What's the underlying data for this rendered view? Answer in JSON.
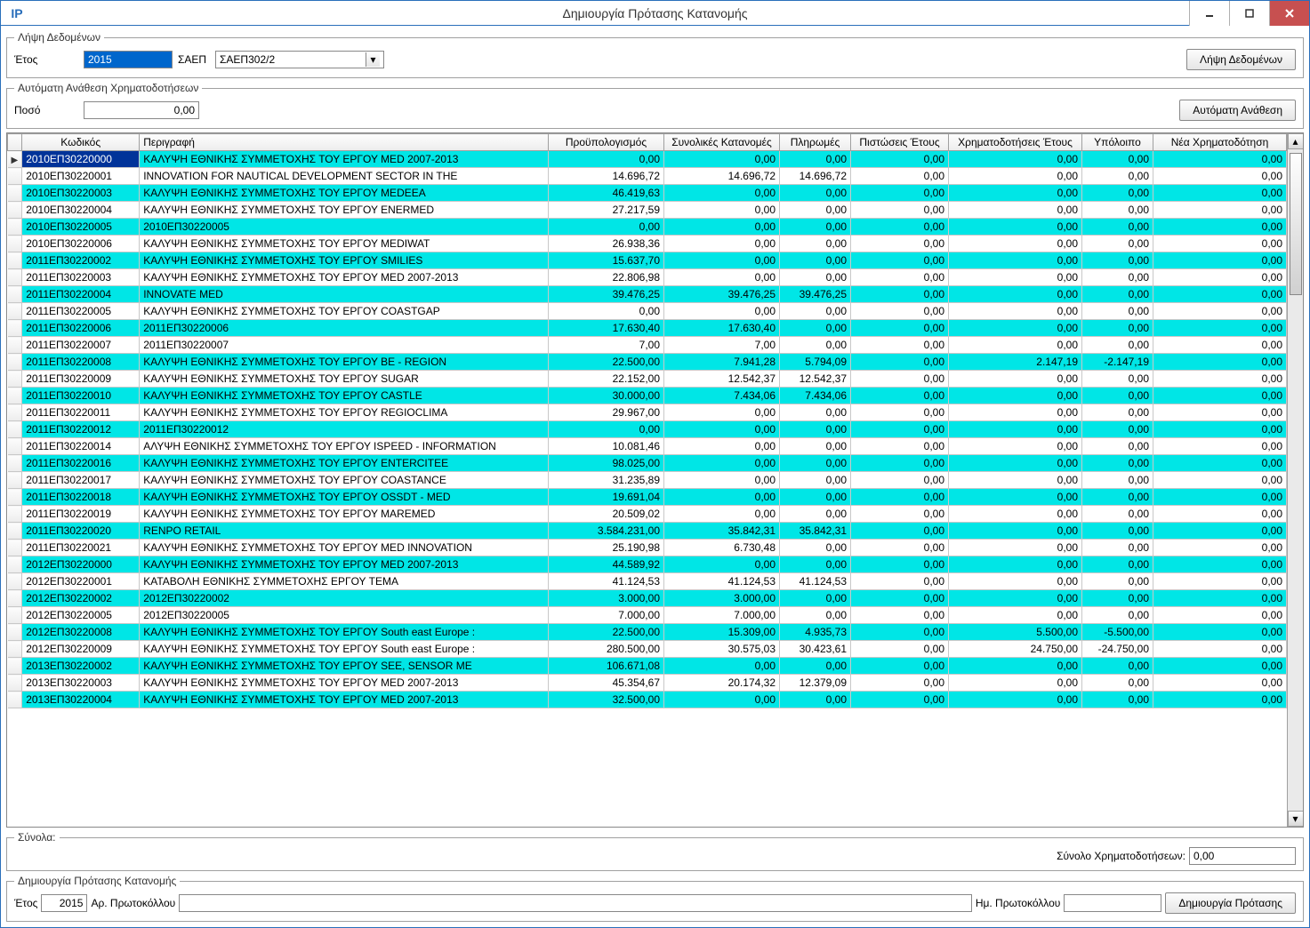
{
  "window": {
    "title": "Δημιουργία Πρότασης Κατανομής"
  },
  "section_fetch": {
    "legend": "Λήψη Δεδομένων",
    "year_label": "Έτος",
    "year_value": "2015",
    "saep_label": "ΣΑΕΠ",
    "saep_value": "ΣΑΕΠ302/2",
    "button": "Λήψη Δεδομένων"
  },
  "section_auto": {
    "legend": "Αυτόματη Ανάθεση Χρηματοδοτήσεων",
    "amount_label": "Ποσό",
    "amount_value": "0,00",
    "button": "Αυτόματη Ανάθεση"
  },
  "columns": {
    "code": "Κωδικός",
    "desc": "Περιγραφή",
    "budget": "Προϋπολογισμός",
    "total_alloc": "Συνολικές Κατανομές",
    "payments": "Πληρωμές",
    "year_credit": "Πιστώσεις Έτους",
    "year_fund": "Χρηματοδοτήσεις Έτους",
    "balance": "Υπόλοιπο",
    "new_fund": "Νέα Χρηματοδότηση"
  },
  "rows": [
    {
      "hi": true,
      "sel": true,
      "code": "2010ΕΠ30220000",
      "desc": "ΚΑΛΥΨΗ ΕΘΝΙΚΗΣ ΣΥΜΜΕΤΟΧΗΣ ΤΟΥ ΕΡΓΟΥ MED 2007-2013",
      "budget": "0,00",
      "alloc": "0,00",
      "pay": "0,00",
      "credit": "0,00",
      "fund": "0,00",
      "bal": "0,00",
      "new": "0,00"
    },
    {
      "hi": false,
      "code": "2010ΕΠ30220001",
      "desc": "INNOVATION FOR NAUTICAL DEVELOPMENT SECTOR IN THE",
      "budget": "14.696,72",
      "alloc": "14.696,72",
      "pay": "14.696,72",
      "credit": "0,00",
      "fund": "0,00",
      "bal": "0,00",
      "new": "0,00"
    },
    {
      "hi": true,
      "code": "2010ΕΠ30220003",
      "desc": "ΚΑΛΥΨΗ ΕΘΝΙΚΗΣ ΣΥΜΜΕΤΟΧΗΣ ΤΟΥ ΕΡΓΟΥ MEDEEA",
      "budget": "46.419,63",
      "alloc": "0,00",
      "pay": "0,00",
      "credit": "0,00",
      "fund": "0,00",
      "bal": "0,00",
      "new": "0,00"
    },
    {
      "hi": false,
      "code": "2010ΕΠ30220004",
      "desc": "ΚΑΛΥΨΗ ΕΘΝΙΚΗΣ ΣΥΜΜΕΤΟΧΗΣ ΤΟΥ ΕΡΓΟΥ ENERMED",
      "budget": "27.217,59",
      "alloc": "0,00",
      "pay": "0,00",
      "credit": "0,00",
      "fund": "0,00",
      "bal": "0,00",
      "new": "0,00"
    },
    {
      "hi": true,
      "code": "2010ΕΠ30220005",
      "desc": "2010ΕΠ30220005",
      "budget": "0,00",
      "alloc": "0,00",
      "pay": "0,00",
      "credit": "0,00",
      "fund": "0,00",
      "bal": "0,00",
      "new": "0,00"
    },
    {
      "hi": false,
      "code": "2010ΕΠ30220006",
      "desc": "ΚΑΛΥΨΗ ΕΘΝΙΚΗΣ ΣΥΜΜΕΤΟΧΗΣ ΤΟΥ ΕΡΓΟΥ MEDIWAT",
      "budget": "26.938,36",
      "alloc": "0,00",
      "pay": "0,00",
      "credit": "0,00",
      "fund": "0,00",
      "bal": "0,00",
      "new": "0,00"
    },
    {
      "hi": true,
      "code": "2011ΕΠ30220002",
      "desc": "ΚΑΛΥΨΗ ΕΘΝΙΚΗΣ ΣΥΜΜΕΤΟΧΗΣ ΤΟΥ ΕΡΓΟΥ SMILIES",
      "budget": "15.637,70",
      "alloc": "0,00",
      "pay": "0,00",
      "credit": "0,00",
      "fund": "0,00",
      "bal": "0,00",
      "new": "0,00"
    },
    {
      "hi": false,
      "code": "2011ΕΠ30220003",
      "desc": "ΚΑΛΥΨΗ ΕΘΝΙΚΗΣ ΣΥΜΜΕΤΟΧΗΣ ΤΟΥ ΕΡΓΟΥ MED 2007-2013",
      "budget": "22.806,98",
      "alloc": "0,00",
      "pay": "0,00",
      "credit": "0,00",
      "fund": "0,00",
      "bal": "0,00",
      "new": "0,00"
    },
    {
      "hi": true,
      "code": "2011ΕΠ30220004",
      "desc": "INNOVATE MED",
      "budget": "39.476,25",
      "alloc": "39.476,25",
      "pay": "39.476,25",
      "credit": "0,00",
      "fund": "0,00",
      "bal": "0,00",
      "new": "0,00"
    },
    {
      "hi": false,
      "code": "2011ΕΠ30220005",
      "desc": "ΚΑΛΥΨΗ ΕΘΝΙΚΗΣ ΣΥΜΜΕΤΟΧΗΣ ΤΟΥ ΕΡΓΟΥ COASTGAP",
      "budget": "0,00",
      "alloc": "0,00",
      "pay": "0,00",
      "credit": "0,00",
      "fund": "0,00",
      "bal": "0,00",
      "new": "0,00"
    },
    {
      "hi": true,
      "code": "2011ΕΠ30220006",
      "desc": "2011ΕΠ30220006",
      "budget": "17.630,40",
      "alloc": "17.630,40",
      "pay": "0,00",
      "credit": "0,00",
      "fund": "0,00",
      "bal": "0,00",
      "new": "0,00"
    },
    {
      "hi": false,
      "code": "2011ΕΠ30220007",
      "desc": "2011ΕΠ30220007",
      "budget": "7,00",
      "alloc": "7,00",
      "pay": "0,00",
      "credit": "0,00",
      "fund": "0,00",
      "bal": "0,00",
      "new": "0,00"
    },
    {
      "hi": true,
      "code": "2011ΕΠ30220008",
      "desc": "ΚΑΛΥΨΗ ΕΘΝΙΚΗΣ ΣΥΜΜΕΤΟΧΗΣ ΤΟΥ ΕΡΓΟΥ BE - REGION",
      "budget": "22.500,00",
      "alloc": "7.941,28",
      "pay": "5.794,09",
      "credit": "0,00",
      "fund": "2.147,19",
      "bal": "-2.147,19",
      "new": "0,00"
    },
    {
      "hi": false,
      "code": "2011ΕΠ30220009",
      "desc": "ΚΑΛΥΨΗ ΕΘΝΙΚΗΣ ΣΥΜΜΕΤΟΧΗΣ ΤΟΥ ΕΡΓΟΥ SUGAR",
      "budget": "22.152,00",
      "alloc": "12.542,37",
      "pay": "12.542,37",
      "credit": "0,00",
      "fund": "0,00",
      "bal": "0,00",
      "new": "0,00"
    },
    {
      "hi": true,
      "code": "2011ΕΠ30220010",
      "desc": "ΚΑΛΥΨΗ ΕΘΝΙΚΗΣ ΣΥΜΜΕΤΟΧΗΣ ΤΟΥ ΕΡΓΟΥ CASTLE",
      "budget": "30.000,00",
      "alloc": "7.434,06",
      "pay": "7.434,06",
      "credit": "0,00",
      "fund": "0,00",
      "bal": "0,00",
      "new": "0,00"
    },
    {
      "hi": false,
      "code": "2011ΕΠ30220011",
      "desc": "ΚΑΛΥΨΗ ΕΘΝΙΚΗΣ ΣΥΜΜΕΤΟΧΗΣ ΤΟΥ ΕΡΓΟΥ REGIOCLIMA",
      "budget": "29.967,00",
      "alloc": "0,00",
      "pay": "0,00",
      "credit": "0,00",
      "fund": "0,00",
      "bal": "0,00",
      "new": "0,00"
    },
    {
      "hi": true,
      "code": "2011ΕΠ30220012",
      "desc": "2011ΕΠ30220012",
      "budget": "0,00",
      "alloc": "0,00",
      "pay": "0,00",
      "credit": "0,00",
      "fund": "0,00",
      "bal": "0,00",
      "new": "0,00"
    },
    {
      "hi": false,
      "code": "2011ΕΠ30220014",
      "desc": "ΑΛΥΨΗ ΕΘΝΙΚΗΣ ΣΥΜΜΕΤΟΧΗΣ ΤΟΥ ΕΡΓΟΥ ISPEED - INFORMATION",
      "budget": "10.081,46",
      "alloc": "0,00",
      "pay": "0,00",
      "credit": "0,00",
      "fund": "0,00",
      "bal": "0,00",
      "new": "0,00"
    },
    {
      "hi": true,
      "code": "2011ΕΠ30220016",
      "desc": "ΚΑΛΥΨΗ ΕΘΝΙΚΗΣ ΣΥΜΜΕΤΟΧΗΣ ΤΟΥ ΕΡΓΟΥ ENTERCITEE",
      "budget": "98.025,00",
      "alloc": "0,00",
      "pay": "0,00",
      "credit": "0,00",
      "fund": "0,00",
      "bal": "0,00",
      "new": "0,00"
    },
    {
      "hi": false,
      "code": "2011ΕΠ30220017",
      "desc": "ΚΑΛΥΨΗ ΕΘΝΙΚΗΣ ΣΥΜΜΕΤΟΧΗΣ ΤΟΥ ΕΡΓΟΥ COASTANCE",
      "budget": "31.235,89",
      "alloc": "0,00",
      "pay": "0,00",
      "credit": "0,00",
      "fund": "0,00",
      "bal": "0,00",
      "new": "0,00"
    },
    {
      "hi": true,
      "code": "2011ΕΠ30220018",
      "desc": "ΚΑΛΥΨΗ ΕΘΝΙΚΗΣ ΣΥΜΜΕΤΟΧΗΣ ΤΟΥ ΕΡΓΟΥ OSSDT - MED",
      "budget": "19.691,04",
      "alloc": "0,00",
      "pay": "0,00",
      "credit": "0,00",
      "fund": "0,00",
      "bal": "0,00",
      "new": "0,00"
    },
    {
      "hi": false,
      "code": "2011ΕΠ30220019",
      "desc": "ΚΑΛΥΨΗ ΕΘΝΙΚΗΣ ΣΥΜΜΕΤΟΧΗΣ ΤΟΥ ΕΡΓΟΥ MAREMED",
      "budget": "20.509,02",
      "alloc": "0,00",
      "pay": "0,00",
      "credit": "0,00",
      "fund": "0,00",
      "bal": "0,00",
      "new": "0,00"
    },
    {
      "hi": true,
      "code": "2011ΕΠ30220020",
      "desc": "RENPO RETAIL",
      "budget": "3.584.231,00",
      "alloc": "35.842,31",
      "pay": "35.842,31",
      "credit": "0,00",
      "fund": "0,00",
      "bal": "0,00",
      "new": "0,00"
    },
    {
      "hi": false,
      "code": "2011ΕΠ30220021",
      "desc": "ΚΑΛΥΨΗ ΕΘΝΙΚΗΣ ΣΥΜΜΕΤΟΧΗΣ ΤΟΥ ΕΡΓΟΥ MED INNOVATION",
      "budget": "25.190,98",
      "alloc": "6.730,48",
      "pay": "0,00",
      "credit": "0,00",
      "fund": "0,00",
      "bal": "0,00",
      "new": "0,00"
    },
    {
      "hi": true,
      "code": "2012ΕΠ30220000",
      "desc": "ΚΑΛΥΨΗ ΕΘΝΙΚΗΣ ΣΥΜΜΕΤΟΧΗΣ ΤΟΥ ΕΡΓΟΥ MED 2007-2013",
      "budget": "44.589,92",
      "alloc": "0,00",
      "pay": "0,00",
      "credit": "0,00",
      "fund": "0,00",
      "bal": "0,00",
      "new": "0,00"
    },
    {
      "hi": false,
      "code": "2012ΕΠ30220001",
      "desc": "ΚΑΤΑΒΟΛΗ ΕΘΝΙΚΗΣ ΣΥΜΜΕΤΟΧΗΣ ΕΡΓΟΥ TEMA",
      "budget": "41.124,53",
      "alloc": "41.124,53",
      "pay": "41.124,53",
      "credit": "0,00",
      "fund": "0,00",
      "bal": "0,00",
      "new": "0,00"
    },
    {
      "hi": true,
      "code": "2012ΕΠ30220002",
      "desc": "2012ΕΠ30220002",
      "budget": "3.000,00",
      "alloc": "3.000,00",
      "pay": "0,00",
      "credit": "0,00",
      "fund": "0,00",
      "bal": "0,00",
      "new": "0,00"
    },
    {
      "hi": false,
      "code": "2012ΕΠ30220005",
      "desc": "2012ΕΠ30220005",
      "budget": "7.000,00",
      "alloc": "7.000,00",
      "pay": "0,00",
      "credit": "0,00",
      "fund": "0,00",
      "bal": "0,00",
      "new": "0,00"
    },
    {
      "hi": true,
      "code": "2012ΕΠ30220008",
      "desc": "ΚΑΛΥΨΗ ΕΘΝΙΚΗΣ ΣΥΜΜΕΤΟΧΗΣ ΤΟΥ ΕΡΓΟΥ South east Europe :",
      "budget": "22.500,00",
      "alloc": "15.309,00",
      "pay": "4.935,73",
      "credit": "0,00",
      "fund": "5.500,00",
      "bal": "-5.500,00",
      "new": "0,00"
    },
    {
      "hi": false,
      "code": "2012ΕΠ30220009",
      "desc": "ΚΑΛΥΨΗ ΕΘΝΙΚΗΣ ΣΥΜΜΕΤΟΧΗΣ ΤΟΥ ΕΡΓΟΥ South east Europe :",
      "budget": "280.500,00",
      "alloc": "30.575,03",
      "pay": "30.423,61",
      "credit": "0,00",
      "fund": "24.750,00",
      "bal": "-24.750,00",
      "new": "0,00"
    },
    {
      "hi": true,
      "code": "2013ΕΠ30220002",
      "desc": "ΚΑΛΥΨΗ ΕΘΝΙΚΗΣ ΣΥΜΜΕΤΟΧΗΣ ΤΟΥ ΕΡΓΟΥ SEE, SENSOR ME",
      "budget": "106.671,08",
      "alloc": "0,00",
      "pay": "0,00",
      "credit": "0,00",
      "fund": "0,00",
      "bal": "0,00",
      "new": "0,00"
    },
    {
      "hi": false,
      "code": "2013ΕΠ30220003",
      "desc": "ΚΑΛΥΨΗ ΕΘΝΙΚΗΣ ΣΥΜΜΕΤΟΧΗΣ ΤΟΥ ΕΡΓΟΥ MED 2007-2013",
      "budget": "45.354,67",
      "alloc": "20.174,32",
      "pay": "12.379,09",
      "credit": "0,00",
      "fund": "0,00",
      "bal": "0,00",
      "new": "0,00"
    },
    {
      "hi": true,
      "code": "2013ΕΠ30220004",
      "desc": "ΚΑΛΥΨΗ ΕΘΝΙΚΗΣ ΣΥΜΜΕΤΟΧΗΣ ΤΟΥ ΕΡΓΟΥ MED 2007-2013",
      "budget": "32.500,00",
      "alloc": "0,00",
      "pay": "0,00",
      "credit": "0,00",
      "fund": "0,00",
      "bal": "0,00",
      "new": "0,00"
    }
  ],
  "totals": {
    "legend": "Σύνολα:",
    "total_fund_label": "Σύνολο Χρηματοδοτήσεων:",
    "total_fund_value": "0,00"
  },
  "create": {
    "legend": "Δημιουργία Πρότασης Κατανομής",
    "year_label": "Έτος",
    "year_value": "2015",
    "protocol_no_label": "Αρ. Πρωτοκόλλου",
    "protocol_no_value": "",
    "protocol_date_label": "Ημ. Πρωτοκόλλου",
    "protocol_date_value": "",
    "button": "Δημιουργία Πρότασης"
  }
}
